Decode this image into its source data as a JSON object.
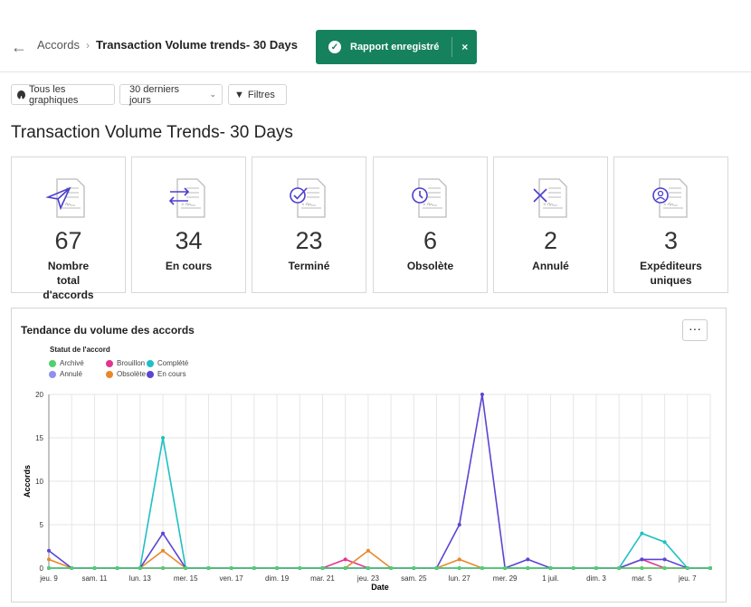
{
  "header": {
    "breadcrumb_parent": "Accords",
    "breadcrumb_current": "Transaction Volume trends- 30 Days"
  },
  "toast": {
    "message": "Rapport enregistré",
    "close": "×"
  },
  "toolbar": {
    "all_charts": "Tous les graphiques",
    "period": "30 derniers jours",
    "filters": "Filtres"
  },
  "page_title": "Transaction Volume Trends- 30 Days",
  "cards": [
    {
      "value": "67",
      "label": "Nombre total d'accords",
      "icon": "send-icon"
    },
    {
      "value": "34",
      "label": "En cours",
      "icon": "arrows-exchange-icon"
    },
    {
      "value": "23",
      "label": "Terminé",
      "icon": "check-circle-icon"
    },
    {
      "value": "6",
      "label": "Obsolète",
      "icon": "clock-icon"
    },
    {
      "value": "2",
      "label": "Annulé",
      "icon": "x-icon"
    },
    {
      "value": "3",
      "label": "Expéditeurs uniques",
      "icon": "user-circle-icon"
    }
  ],
  "accent": "#4b3fcf",
  "panel": {
    "title": "Tendance du volume des accords",
    "more": "···"
  },
  "chart_data": {
    "type": "line",
    "legend_title": "Statut de l'accord",
    "legend_placement": "top-left",
    "xlabel": "Date",
    "ylabel": "Accords",
    "ylim": [
      0,
      20
    ],
    "yticks": [
      0,
      5,
      10,
      15,
      20
    ],
    "grid": true,
    "x": [
      "2022-06-09",
      "2022-06-10",
      "2022-06-11",
      "2022-06-12",
      "2022-06-13",
      "2022-06-14",
      "2022-06-15",
      "2022-06-16",
      "2022-06-17",
      "2022-06-18",
      "2022-06-19",
      "2022-06-20",
      "2022-06-21",
      "2022-06-22",
      "2022-06-23",
      "2022-06-24",
      "2022-06-25",
      "2022-06-26",
      "2022-06-27",
      "2022-06-28",
      "2022-06-29",
      "2022-06-30",
      "2022-07-01",
      "2022-07-02",
      "2022-07-03",
      "2022-07-04",
      "2022-07-05",
      "2022-07-06",
      "2022-07-07",
      "2022-07-08"
    ],
    "xtick_labels": [
      "jeu. 9",
      "sam. 11",
      "lun. 13",
      "mer. 15",
      "ven. 17",
      "dim. 19",
      "mar. 21",
      "jeu. 23",
      "sam. 25",
      "lun. 27",
      "mer. 29",
      "1 juil.",
      "dim. 3",
      "mar. 5",
      "jeu. 7"
    ],
    "series": [
      {
        "name": "Annulé",
        "color": "#8f8ff0",
        "values": [
          0,
          0,
          0,
          0,
          0,
          0,
          0,
          0,
          0,
          0,
          0,
          0,
          0,
          0,
          0,
          0,
          0,
          0,
          0,
          0,
          0,
          0,
          0,
          0,
          0,
          0,
          0,
          0,
          0,
          0
        ]
      },
      {
        "name": "Brouillon",
        "color": "#e0368f",
        "values": [
          0,
          0,
          0,
          0,
          0,
          0,
          0,
          0,
          0,
          0,
          0,
          0,
          0,
          1,
          0,
          0,
          0,
          0,
          0,
          0,
          0,
          0,
          0,
          0,
          0,
          0,
          1,
          0,
          0,
          0
        ]
      },
      {
        "name": "Obsolète",
        "color": "#e8882a",
        "values": [
          1,
          0,
          0,
          0,
          0,
          2,
          0,
          0,
          0,
          0,
          0,
          0,
          0,
          0,
          2,
          0,
          0,
          0,
          1,
          0,
          0,
          0,
          0,
          0,
          0,
          0,
          0,
          0,
          0,
          0
        ]
      },
      {
        "name": "Complété",
        "color": "#1fbfc4",
        "values": [
          0,
          0,
          0,
          0,
          0,
          15,
          0,
          0,
          0,
          0,
          0,
          0,
          0,
          0,
          0,
          0,
          0,
          0,
          0,
          0,
          0,
          0,
          0,
          0,
          0,
          0,
          4,
          3,
          0,
          0
        ]
      },
      {
        "name": "En cours",
        "color": "#5a45d4",
        "values": [
          2,
          0,
          0,
          0,
          0,
          4,
          0,
          0,
          0,
          0,
          0,
          0,
          0,
          0,
          0,
          0,
          0,
          0,
          5,
          20,
          0,
          1,
          0,
          0,
          0,
          0,
          1,
          1,
          0,
          0
        ]
      },
      {
        "name": "Archivé",
        "color": "#50d070",
        "values": [
          0,
          0,
          0,
          0,
          0,
          0,
          0,
          0,
          0,
          0,
          0,
          0,
          0,
          0,
          0,
          0,
          0,
          0,
          0,
          0,
          0,
          0,
          0,
          0,
          0,
          0,
          0,
          0,
          0,
          0
        ]
      }
    ],
    "legend_order": [
      "Archivé",
      "Brouillon",
      "Complété",
      "Annulé",
      "Obsolète",
      "En cours"
    ]
  }
}
